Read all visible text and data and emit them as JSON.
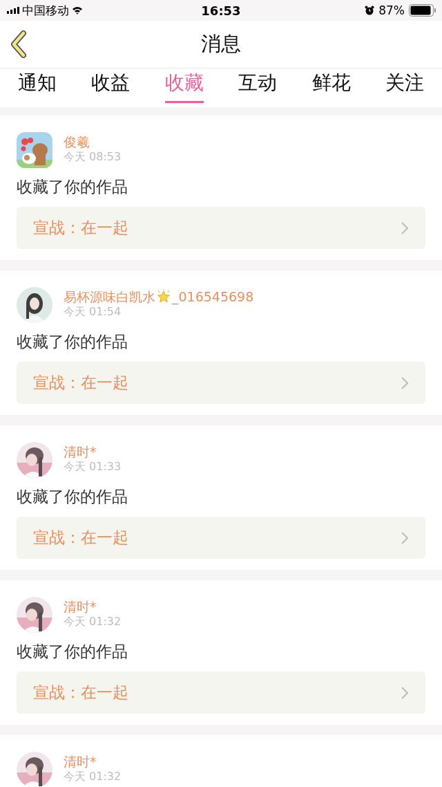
{
  "status_bar": {
    "carrier": "中国移动",
    "time": "16:53",
    "battery": "87%"
  },
  "nav": {
    "title": "消息"
  },
  "tabs": [
    {
      "label": "通知",
      "selected": false
    },
    {
      "label": "收益",
      "selected": false
    },
    {
      "label": "收藏",
      "selected": true
    },
    {
      "label": "互动",
      "selected": false
    },
    {
      "label": "鲜花",
      "selected": false
    },
    {
      "label": "关注",
      "selected": false
    }
  ],
  "messages": [
    {
      "avatar": {
        "kind": "illustration"
      },
      "name": "俊羲",
      "star_badge": false,
      "time": "今天 08:53",
      "text": "收藏了你的作品",
      "link": "宣战：在一起"
    },
    {
      "name": "易杯源味白凯水",
      "star_badge": true,
      "name_suffix": "_016545698",
      "time": "今天 01:54",
      "text": "收藏了你的作品",
      "link": "宣战：在一起"
    },
    {
      "name": "清时*",
      "star_badge": false,
      "time": "今天 01:33",
      "text": "收藏了你的作品",
      "link": "宣战：在一起"
    },
    {
      "name": "清时*",
      "star_badge": false,
      "time": "今天 01:32",
      "text": "收藏了你的作品",
      "link": "宣战：在一起"
    },
    {
      "name": "清时*",
      "star_badge": false,
      "time": "今天 01:32"
    }
  ]
}
